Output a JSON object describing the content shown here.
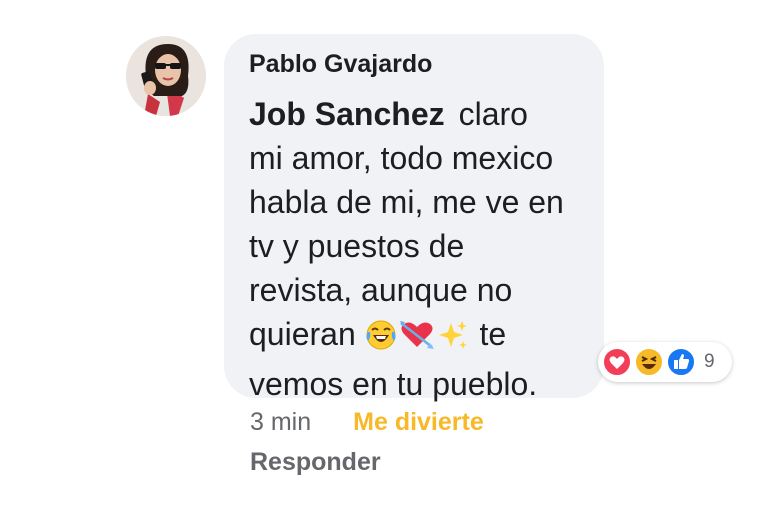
{
  "comment": {
    "author": "Pablo Gvajardo",
    "mention": "Job  Sanchez",
    "lines": [
      "claro",
      "mi amor, todo mexico",
      "habla de mi, me ve en",
      "tv y puestos de",
      "revista, aunque no"
    ],
    "line_before_emoji": "quieran",
    "line_after_emoji": "te",
    "last_line": "vemos en tu pueblo.",
    "emojis": [
      "laughing-tears-emoji",
      "heart-arrow-emoji",
      "sparkles-emoji"
    ]
  },
  "reactions": {
    "icons": [
      "love-reaction-icon",
      "haha-reaction-icon",
      "like-reaction-icon"
    ],
    "count": "9"
  },
  "meta": {
    "time": "3 min",
    "reaction_label": "Me divierte",
    "reply_label": "Responder"
  },
  "colors": {
    "bubble_bg": "#f0f2f5",
    "meta_text": "#65676b",
    "haha_yellow": "#f7b928",
    "love_red": "#f33e58",
    "like_blue": "#1877f2"
  }
}
